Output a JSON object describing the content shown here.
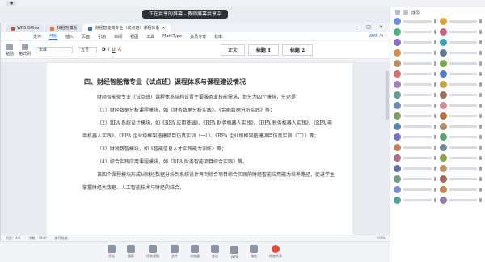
{
  "app": {
    "share_title": "正在共享的屏幕 - 教师屏幕共享中",
    "window_tabs": [
      {
        "label": "WPS Office",
        "color": "#e14c3c"
      },
      {
        "label": "找稻壳模板",
        "color": "#e8743b"
      },
      {
        "label": "财经智能微专业（试点班）课程体系",
        "color": "#2f6fde"
      }
    ],
    "menu": [
      "文件",
      "开始",
      "插入",
      "页面",
      "引用",
      "审阅",
      "视图",
      "工具",
      "MathType",
      "会员专享",
      "效率"
    ],
    "active_menu": "开始",
    "ai_label": "WPS AI",
    "ribbon": {
      "format_painter": "格式刷",
      "paste": "粘贴",
      "font_name": "宋体",
      "font_size": "五号",
      "format_glyphs": [
        "B",
        "I",
        "U",
        "A"
      ],
      "styles": [
        "正文",
        "标题 1",
        "标题 2"
      ]
    }
  },
  "document": {
    "heading": "四、财经智能微专业（试点班）课程体系与课程建设情况",
    "paragraphs": [
      {
        "text": "财经智能微专业（试点班）课程体系结构设置主要服务业技能需求，划分为四个模块，分述是：",
        "indent": true
      },
      {
        "text": "（1）财经数据分析课程模块，如《财务数据分析实践》、《金融数据分析实践》等；",
        "indent": true
      },
      {
        "text": "（2）RPA 系统设计模块，如《RPA 应用基础》、《RPA 财务机器人实践》、《RPA 税务机器人实践》、《RPA 电商机器人实践》、《RPA 企业级框架搭建项目仿真实训（一）》、《RPA 企业级框架搭建项目仿真实训（二）》等；",
        "indent": true
      },
      {
        "text": "（3）财税数智模块，如《智能信息人才实践能力训练》等；",
        "indent": true
      },
      {
        "text": "（4）综合实践应用课程模块，如《RPA 财务智能项目综合实践》等。",
        "indent": true
      },
      {
        "text": "该四个课程模块形成从财经数据分析到系统设计再到综合项目综合实践的财经智能应用能力培养路径，促进学生掌握财经大数据、人工智能技术与财经的结合，",
        "indent": true
      }
    ]
  },
  "status": {
    "page": "页面：4/6",
    "words": "字数：2846",
    "spell": "拼写检查",
    "zoom": "100%"
  },
  "taskbar": [
    {
      "label": "开始",
      "icon": "windows-icon"
    },
    {
      "label": "搜索",
      "icon": "search-icon"
    },
    {
      "label": "任务视图",
      "icon": "task-view-icon"
    },
    {
      "label": "文件",
      "icon": "folder-icon"
    },
    {
      "label": "浏览器",
      "icon": "browser-icon"
    },
    {
      "label": "会议",
      "icon": "meeting-icon"
    },
    {
      "label": "WPS",
      "icon": "wps-icon"
    },
    {
      "label": "微信",
      "icon": "wechat-icon"
    },
    {
      "label": "结束共享",
      "icon": "stop-share-icon",
      "danger": true
    }
  ],
  "participants": {
    "title": "成员",
    "avatar_colors": [
      "#6b8fd6",
      "#e0a33c",
      "#4bb07a",
      "#c9637a",
      "#8a6fc8",
      "#3aa6b9",
      "#d98b4a",
      "#5f7c99",
      "#b58e6a",
      "#7aa84d",
      "#d66c6c",
      "#4d7fc2",
      "#a87bb5",
      "#c4a24a",
      "#5c9e8f",
      "#9c6f5a",
      "#6a88b8",
      "#d18a9a",
      "#7f9b5e",
      "#ba7040",
      "#4f8bb0",
      "#a68f6b",
      "#7b6fbf",
      "#58a36e",
      "#c7815a",
      "#6e8e9c",
      "#b06a8c",
      "#8aa14f",
      "#5b72a8",
      "#c09060",
      "#6d9c7e",
      "#a7675f",
      "#7c8cc6",
      "#c28856",
      "#5e9aa4",
      "#9a7aa8"
    ]
  }
}
